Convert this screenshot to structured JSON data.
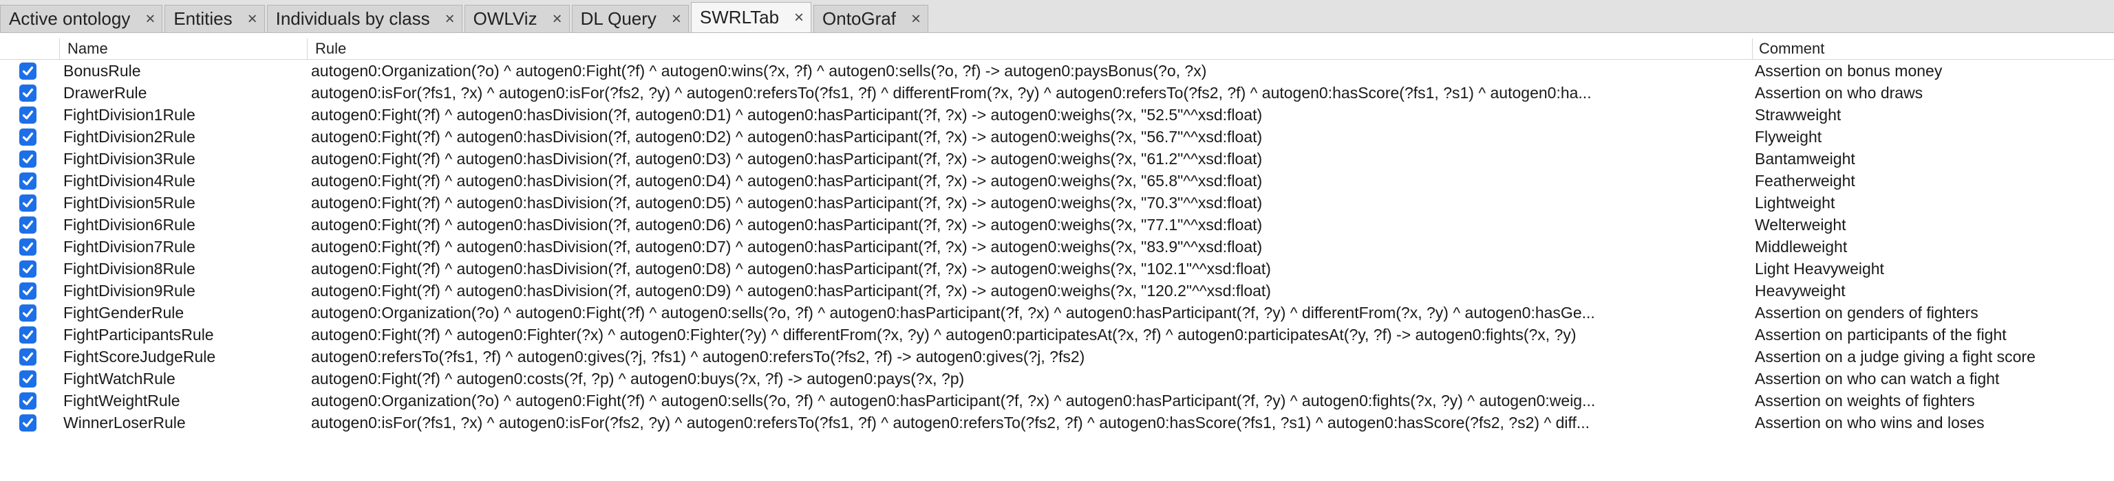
{
  "tabs": [
    {
      "label": "Active ontology",
      "active": false
    },
    {
      "label": "Entities",
      "active": false
    },
    {
      "label": "Individuals by class",
      "active": false
    },
    {
      "label": "OWLViz",
      "active": false
    },
    {
      "label": "DL Query",
      "active": false
    },
    {
      "label": "SWRLTab",
      "active": true
    },
    {
      "label": "OntoGraf",
      "active": false
    }
  ],
  "columns": {
    "name": "Name",
    "rule": "Rule",
    "comment": "Comment"
  },
  "rows": [
    {
      "checked": true,
      "name": "BonusRule",
      "rule": "autogen0:Organization(?o) ^ autogen0:Fight(?f) ^ autogen0:wins(?x, ?f) ^ autogen0:sells(?o, ?f) -> autogen0:paysBonus(?o, ?x)",
      "comment": "Assertion on bonus money"
    },
    {
      "checked": true,
      "name": "DrawerRule",
      "rule": "autogen0:isFor(?fs1, ?x) ^ autogen0:isFor(?fs2, ?y) ^ autogen0:refersTo(?fs1, ?f) ^ differentFrom(?x, ?y) ^ autogen0:refersTo(?fs2, ?f) ^ autogen0:hasScore(?fs1, ?s1) ^ autogen0:ha...",
      "comment": "Assertion on who draws"
    },
    {
      "checked": true,
      "name": "FightDivision1Rule",
      "rule": "autogen0:Fight(?f) ^ autogen0:hasDivision(?f, autogen0:D1) ^ autogen0:hasParticipant(?f, ?x) -> autogen0:weighs(?x, \"52.5\"^^xsd:float)",
      "comment": "Strawweight"
    },
    {
      "checked": true,
      "name": "FightDivision2Rule",
      "rule": "autogen0:Fight(?f) ^ autogen0:hasDivision(?f, autogen0:D2) ^ autogen0:hasParticipant(?f, ?x) -> autogen0:weighs(?x, \"56.7\"^^xsd:float)",
      "comment": "Flyweight"
    },
    {
      "checked": true,
      "name": "FightDivision3Rule",
      "rule": "autogen0:Fight(?f) ^ autogen0:hasDivision(?f, autogen0:D3) ^ autogen0:hasParticipant(?f, ?x) -> autogen0:weighs(?x, \"61.2\"^^xsd:float)",
      "comment": "Bantamweight"
    },
    {
      "checked": true,
      "name": "FightDivision4Rule",
      "rule": "autogen0:Fight(?f) ^ autogen0:hasDivision(?f, autogen0:D4) ^ autogen0:hasParticipant(?f, ?x) -> autogen0:weighs(?x, \"65.8\"^^xsd:float)",
      "comment": "Featherweight"
    },
    {
      "checked": true,
      "name": "FightDivision5Rule",
      "rule": "autogen0:Fight(?f) ^ autogen0:hasDivision(?f, autogen0:D5) ^ autogen0:hasParticipant(?f, ?x) -> autogen0:weighs(?x, \"70.3\"^^xsd:float)",
      "comment": "Lightweight"
    },
    {
      "checked": true,
      "name": "FightDivision6Rule",
      "rule": "autogen0:Fight(?f) ^ autogen0:hasDivision(?f, autogen0:D6) ^ autogen0:hasParticipant(?f, ?x) -> autogen0:weighs(?x, \"77.1\"^^xsd:float)",
      "comment": "Welterweight"
    },
    {
      "checked": true,
      "name": "FightDivision7Rule",
      "rule": "autogen0:Fight(?f) ^ autogen0:hasDivision(?f, autogen0:D7) ^ autogen0:hasParticipant(?f, ?x) -> autogen0:weighs(?x, \"83.9\"^^xsd:float)",
      "comment": "Middleweight"
    },
    {
      "checked": true,
      "name": "FightDivision8Rule",
      "rule": "autogen0:Fight(?f) ^ autogen0:hasDivision(?f, autogen0:D8) ^ autogen0:hasParticipant(?f, ?x) -> autogen0:weighs(?x, \"102.1\"^^xsd:float)",
      "comment": "Light Heavyweight"
    },
    {
      "checked": true,
      "name": "FightDivision9Rule",
      "rule": "autogen0:Fight(?f) ^ autogen0:hasDivision(?f, autogen0:D9) ^ autogen0:hasParticipant(?f, ?x) -> autogen0:weighs(?x, \"120.2\"^^xsd:float)",
      "comment": "Heavyweight"
    },
    {
      "checked": true,
      "name": "FightGenderRule",
      "rule": "autogen0:Organization(?o) ^ autogen0:Fight(?f) ^ autogen0:sells(?o, ?f) ^ autogen0:hasParticipant(?f, ?x) ^ autogen0:hasParticipant(?f, ?y) ^ differentFrom(?x, ?y) ^ autogen0:hasGe...",
      "comment": "Assertion on genders of fighters"
    },
    {
      "checked": true,
      "name": "FightParticipantsRule",
      "rule": "autogen0:Fight(?f) ^ autogen0:Fighter(?x) ^ autogen0:Fighter(?y) ^ differentFrom(?x, ?y) ^ autogen0:participatesAt(?x, ?f) ^ autogen0:participatesAt(?y, ?f) -> autogen0:fights(?x, ?y)",
      "comment": "Assertion on participants of the fight"
    },
    {
      "checked": true,
      "name": "FightScoreJudgeRule",
      "rule": "autogen0:refersTo(?fs1, ?f) ^ autogen0:gives(?j, ?fs1) ^ autogen0:refersTo(?fs2, ?f) -> autogen0:gives(?j, ?fs2)",
      "comment": "Assertion on a judge giving a fight score"
    },
    {
      "checked": true,
      "name": "FightWatchRule",
      "rule": "autogen0:Fight(?f) ^ autogen0:costs(?f, ?p) ^ autogen0:buys(?x, ?f) -> autogen0:pays(?x, ?p)",
      "comment": "Assertion on who can watch a fight"
    },
    {
      "checked": true,
      "name": "FightWeightRule",
      "rule": "autogen0:Organization(?o) ^ autogen0:Fight(?f) ^ autogen0:sells(?o, ?f) ^ autogen0:hasParticipant(?f, ?x) ^ autogen0:hasParticipant(?f, ?y) ^ autogen0:fights(?x, ?y) ^ autogen0:weig...",
      "comment": "Assertion on weights of fighters"
    },
    {
      "checked": true,
      "name": "WinnerLoserRule",
      "rule": "autogen0:isFor(?fs1, ?x) ^ autogen0:isFor(?fs2, ?y) ^ autogen0:refersTo(?fs1, ?f) ^ autogen0:refersTo(?fs2, ?f) ^ autogen0:hasScore(?fs1, ?s1) ^ autogen0:hasScore(?fs2, ?s2) ^ diff...",
      "comment": "Assertion on who wins and loses"
    }
  ],
  "colors": {
    "checkbox": "#1d6fe8",
    "tabbar": "#e2e2e2",
    "active_tab": "#f6f6f6"
  }
}
